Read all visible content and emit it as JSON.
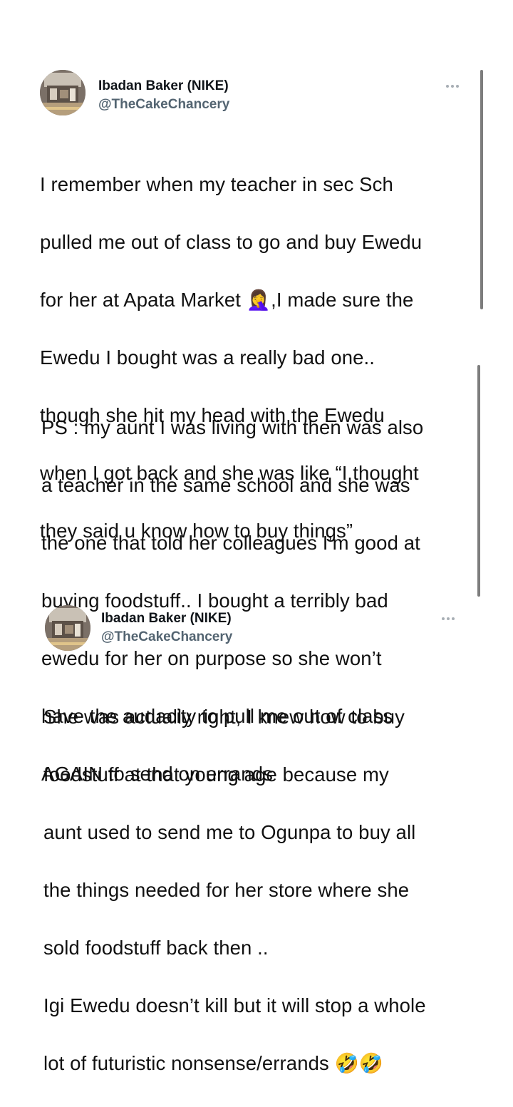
{
  "tweets": [
    {
      "author": {
        "name": "Ibadan Baker (NIKE)",
        "handle": "@TheCakeChancery"
      },
      "paragraphs": [
        {
          "lines": [
            "I remember when my teacher in sec Sch",
            "pulled me out of class to go and buy Ewedu",
            "for her at Apata Market 🤦‍♀️,I made sure the",
            "Ewedu I bought was a really bad one..",
            "though she hit my head with the Ewedu",
            "when I got back and she was like “I thought",
            "they said u know how to buy things”"
          ]
        },
        {
          "lines": [
            "PS : my aunt I was living with then was also",
            "a teacher in the same school and she was",
            "the one that told her colleagues I’m good at",
            "buying foodstuff.. I bought a terribly bad",
            "ewedu for her on purpose so she won’t",
            "have the audacity to pull me out of class",
            "AGAIN to send on errands"
          ]
        }
      ]
    },
    {
      "author": {
        "name": "Ibadan Baker (NIKE)",
        "handle": "@TheCakeChancery"
      },
      "paragraphs": [
        {
          "lines": [
            "She was actually right, I knew how to buy",
            "foodstuff at that young age because my",
            "aunt used to send me to Ogunpa to buy all",
            "the things needed for her store where she",
            "sold foodstuff back then ..",
            "Igi Ewedu doesn’t kill but it will stop a whole",
            "lot of futuristic nonsense/errands 🤣🤣"
          ]
        }
      ]
    }
  ],
  "icons": {
    "more": "more-horizontal-icon",
    "avatar": "avatar-photo"
  },
  "colors": {
    "name": "#0f1419",
    "handle": "#536471",
    "text": "#111111",
    "more": "#a7aeb4",
    "scrollbar": "#7d7d7d"
  }
}
